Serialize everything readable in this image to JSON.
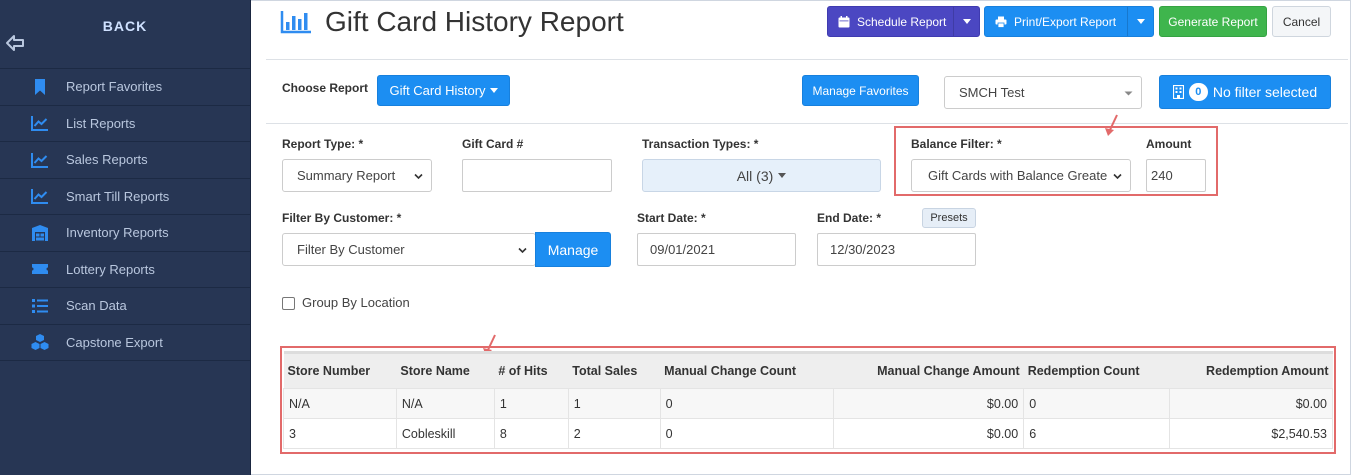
{
  "sidebar": {
    "back_label": "BACK",
    "items": [
      {
        "label": "Report Favorites",
        "icon": "bookmark-icon"
      },
      {
        "label": "List Reports",
        "icon": "line-chart-icon"
      },
      {
        "label": "Sales Reports",
        "icon": "line-chart-icon"
      },
      {
        "label": "Smart Till Reports",
        "icon": "line-chart-icon"
      },
      {
        "label": "Inventory Reports",
        "icon": "warehouse-icon"
      },
      {
        "label": "Lottery Reports",
        "icon": "ticket-icon"
      },
      {
        "label": "Scan Data",
        "icon": "list-icon"
      },
      {
        "label": "Capstone Export",
        "icon": "cubes-icon"
      }
    ]
  },
  "header": {
    "title": "Gift Card History Report",
    "schedule_label": "Schedule Report",
    "print_label": "Print/Export Report",
    "generate_label": "Generate Report",
    "cancel_label": "Cancel"
  },
  "choose": {
    "label": "Choose Report",
    "report_button": "Gift Card History",
    "manage_favorites": "Manage Favorites",
    "store_select": "SMCH Test",
    "filter_count": "0",
    "filter_label": "No filter selected"
  },
  "filters": {
    "report_type_label": "Report Type: *",
    "report_type_value": "Summary Report",
    "gift_card_label": "Gift Card #",
    "gift_card_value": "",
    "transaction_types_label": "Transaction Types: *",
    "transaction_types_value": "All (3)",
    "balance_filter_label": "Balance Filter: *",
    "balance_filter_value": "Gift Cards with Balance Greate",
    "amount_label": "Amount",
    "amount_value": "240",
    "customer_label": "Filter By Customer: *",
    "customer_value": "Filter By Customer",
    "manage_label": "Manage",
    "start_label": "Start Date: *",
    "start_value": "09/01/2021",
    "end_label": "End Date: *",
    "end_value": "12/30/2023",
    "presets_label": "Presets",
    "group_label": "Group By Location"
  },
  "table": {
    "headers": [
      "Store Number",
      "Store Name",
      "# of Hits",
      "Total Sales",
      "Manual Change Count",
      "Manual Change Amount",
      "Redemption Count",
      "Redemption Amount"
    ],
    "rows": [
      [
        "N/A",
        "N/A",
        "1",
        "1",
        "0",
        "$0.00",
        "0",
        "$0.00"
      ],
      [
        "3",
        "Cobleskill",
        "8",
        "2",
        "0",
        "$0.00",
        "6",
        "$2,540.53"
      ]
    ]
  },
  "colors": {
    "sidebar_bg": "#273654",
    "primary_blue": "#1c8ef2",
    "purple": "#4b47c2",
    "green": "#3fb54d",
    "highlight_red": "#e26a6a"
  }
}
